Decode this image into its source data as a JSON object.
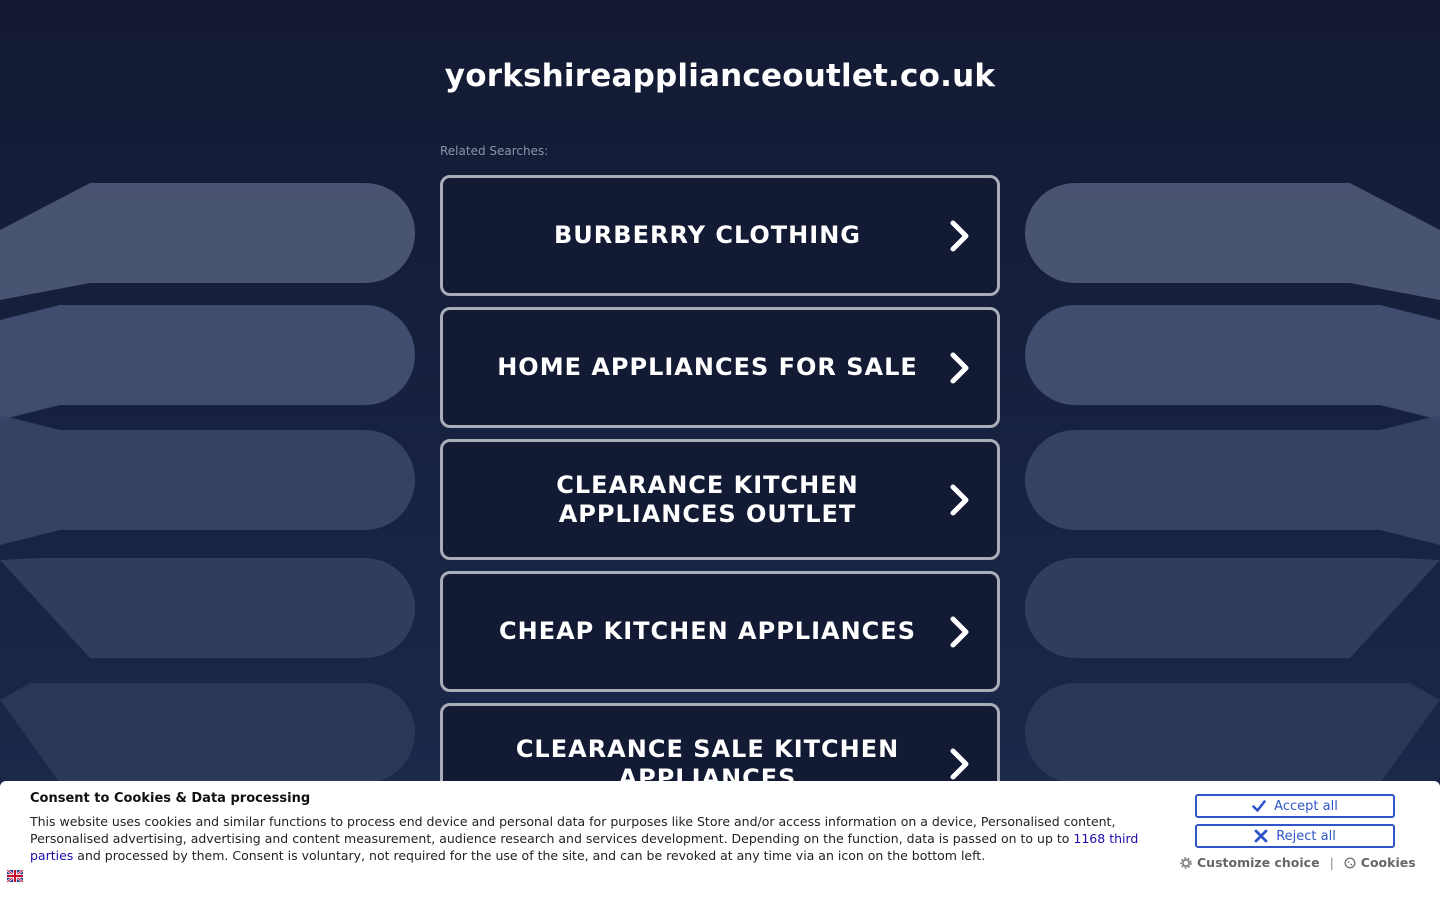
{
  "site": {
    "domain": "yorkshireapplianceoutlet.co.uk",
    "related_label": "Related Searches:"
  },
  "searches": [
    {
      "label": "BURBERRY CLOTHING"
    },
    {
      "label": "HOME APPLIANCES FOR SALE"
    },
    {
      "label": "CLEARANCE KITCHEN APPLIANCES OUTLET"
    },
    {
      "label": "CHEAP KITCHEN APPLIANCES"
    },
    {
      "label": "CLEARANCE SALE KITCHEN APPLIANCES"
    }
  ],
  "consent": {
    "title": "Consent to Cookies & Data processing",
    "body_before": "This website uses cookies and similar functions to process end device and personal data for purposes like Store and/or access information on a device, Personalised content, Personalised advertising, advertising and content measurement, audience research and services development. Depending on the function, data is passed on to up to ",
    "link_text": "1168 third parties",
    "body_after": " and processed by them. Consent is voluntary, not required for the use of the site, and can be revoked at any time via an icon on the bottom left.",
    "accept_label": "Accept all",
    "reject_label": "Reject all",
    "customize_label": "Customize choice",
    "separator": "|",
    "cookies_label": "Cookies"
  },
  "colors": {
    "background": "#131a33",
    "shape": "#4a5573",
    "button_border": "#a9adb8",
    "consent_accent": "#2f55c8"
  },
  "icons": {
    "chevron": "chevron-right-icon",
    "accept": "check-icon",
    "reject": "x-icon",
    "customize": "gear-icon",
    "cookies": "cookie-icon",
    "language": "uk-flag-icon"
  }
}
